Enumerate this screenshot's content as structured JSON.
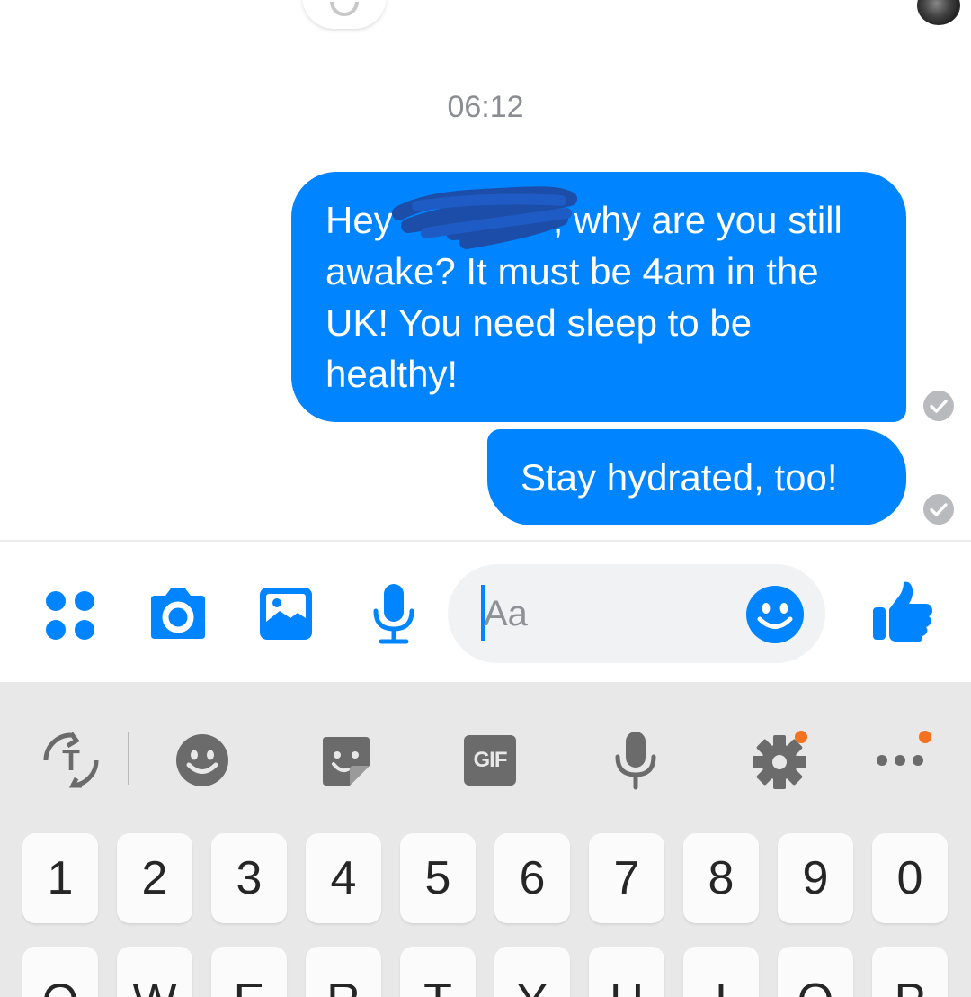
{
  "chat": {
    "timestamp": "06:12",
    "messages": [
      {
        "text": "Hey ▓▓▓▓▓▓▓, why are you still awake? It must be 4am in the UK! You need sleep to be healthy!",
        "before_redaction": "Hey",
        "after_redaction": ", why are you still awake? It must be 4am in the UK! You need sleep to be healthy!",
        "status": "seen-check"
      },
      {
        "text": "Stay hydrated, too!",
        "status": "seen-check"
      }
    ],
    "bubble_color": "#0084ff"
  },
  "composer": {
    "placeholder": "Aa",
    "value": "",
    "icons": [
      "apps-grid-icon",
      "camera-icon",
      "gallery-icon",
      "microphone-icon",
      "emoji-icon",
      "thumbs-up-icon"
    ],
    "accent": "#0084ff"
  },
  "keyboard": {
    "toolbar": {
      "gif_label": "GIF",
      "icons": [
        "translate-icon",
        "emoji-icon",
        "sticker-icon",
        "gif-icon",
        "microphone-icon",
        "settings-icon",
        "more-icon"
      ],
      "notification_color": "#f4711f"
    },
    "number_row": [
      "1",
      "2",
      "3",
      "4",
      "5",
      "6",
      "7",
      "8",
      "9",
      "0"
    ],
    "letter_row": [
      "Q",
      "W",
      "E",
      "R",
      "T",
      "Y",
      "U",
      "I",
      "O",
      "P"
    ]
  }
}
